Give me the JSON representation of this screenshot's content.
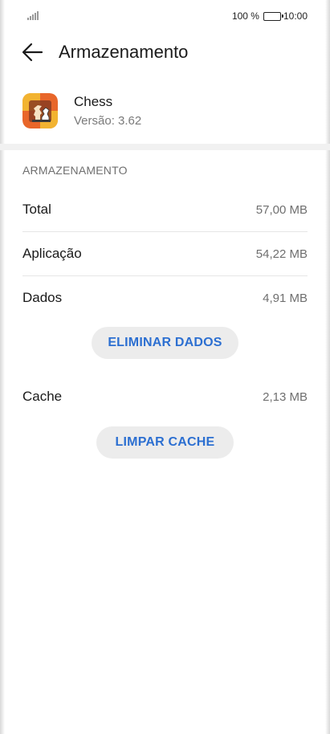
{
  "status_bar": {
    "battery_text": "100 %",
    "time": "10:00"
  },
  "header": {
    "title": "Armazenamento"
  },
  "app": {
    "name": "Chess",
    "version": "Versão: 3.62"
  },
  "storage": {
    "section_title": "ARMAZENAMENTO",
    "rows": [
      {
        "label": "Total",
        "value": "57,00 MB"
      },
      {
        "label": "Aplicação",
        "value": "54,22 MB"
      },
      {
        "label": "Dados",
        "value": "4,91 MB"
      }
    ],
    "clear_data_label": "ELIMINAR DADOS",
    "cache": {
      "label": "Cache",
      "value": "2,13 MB"
    },
    "clear_cache_label": "LIMPAR CACHE"
  },
  "colors": {
    "accent": "#2c6fd1",
    "button_bg": "#ececec",
    "app_icon_orange": "#e8662a",
    "app_icon_yellow": "#f2b331"
  },
  "icons": [
    "signal-icon",
    "battery-icon",
    "back-arrow-icon",
    "chess-app-icon"
  ]
}
